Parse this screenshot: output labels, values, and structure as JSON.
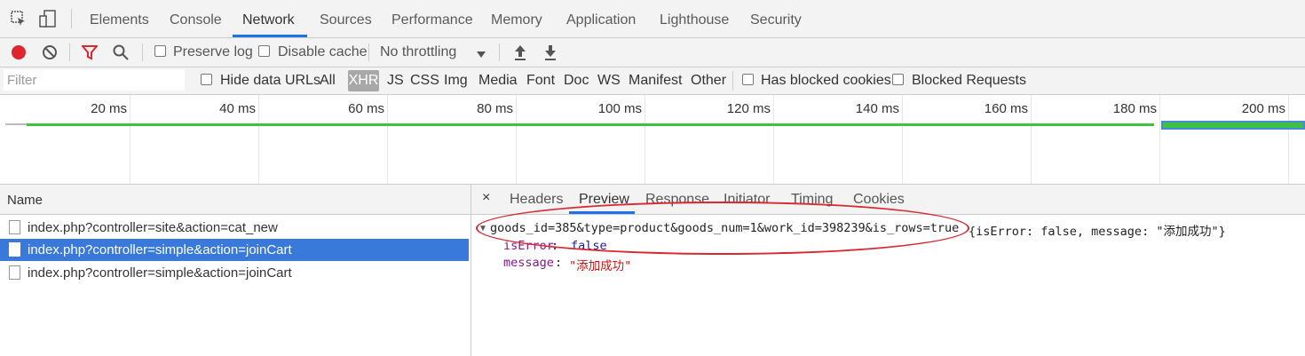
{
  "main_tabs": [
    "Elements",
    "Console",
    "Network",
    "Sources",
    "Performance",
    "Memory",
    "Application",
    "Lighthouse",
    "Security"
  ],
  "toolbar": {
    "preserve_log": "Preserve log",
    "disable_cache": "Disable cache",
    "throttling": "No throttling"
  },
  "filterbar": {
    "filter_placeholder": "Filter",
    "hide_data_urls": "Hide data URLs",
    "types": [
      "All",
      "XHR",
      "JS",
      "CSS",
      "Img",
      "Media",
      "Font",
      "Doc",
      "WS",
      "Manifest",
      "Other"
    ],
    "has_blocked_cookies": "Has blocked cookies",
    "blocked_requests": "Blocked Requests"
  },
  "timeline": {
    "ticks": [
      "20 ms",
      "40 ms",
      "60 ms",
      "80 ms",
      "100 ms",
      "120 ms",
      "140 ms",
      "160 ms",
      "180 ms",
      "200 ms"
    ]
  },
  "requests": {
    "header": "Name",
    "items": [
      {
        "name": "index.php?controller=site&action=cat_new",
        "selected": false
      },
      {
        "name": "index.php?controller=simple&action=joinCart",
        "selected": true
      },
      {
        "name": "index.php?controller=simple&action=joinCart",
        "selected": false
      }
    ]
  },
  "details": {
    "close": "×",
    "tabs": [
      "Headers",
      "Preview",
      "Response",
      "Initiator",
      "Timing",
      "Cookies"
    ],
    "active_tab": "Preview",
    "preview": {
      "summary_key": "goods_id=385&type=product&goods_num=1&work_id=398239&is_rows=true",
      "summary_value": "{isError: false, message: \"添加成功\"}",
      "is_error_key": "isError",
      "is_error_value": "false",
      "message_key": "message",
      "message_value": "\"添加成功\""
    }
  },
  "colors": {
    "accent": "#1a73e8",
    "selected_row": "#3879d9",
    "record": "#e0262d",
    "annotation": "#d9282f",
    "timeline_bar": "#3ec13e"
  }
}
